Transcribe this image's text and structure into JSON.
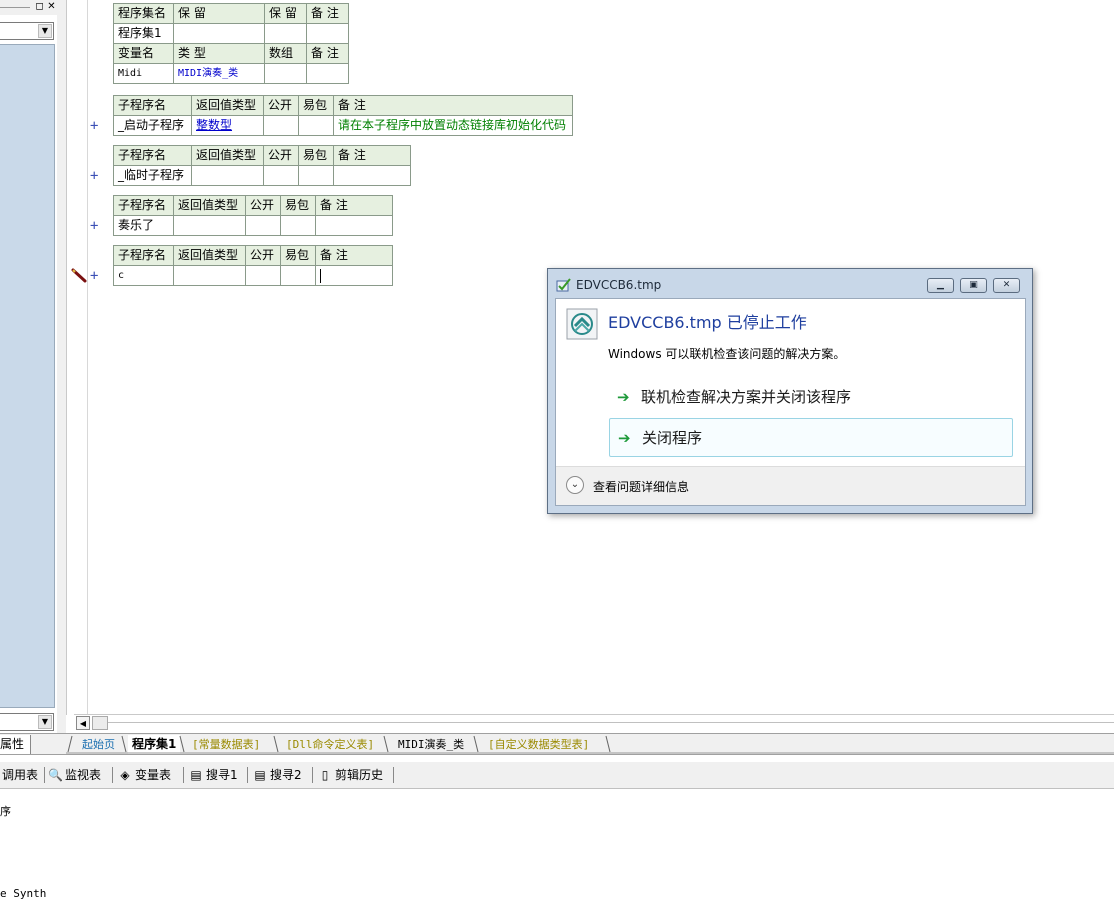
{
  "program_set_table": {
    "header1": [
      "程序集名",
      "保 留",
      "保 留",
      "备 注"
    ],
    "row1": [
      "程序集1",
      "",
      "",
      ""
    ],
    "header2": [
      "变量名",
      "类 型",
      "数组",
      "备 注"
    ],
    "row2": [
      "Midi",
      "MIDI演奏_类",
      "",
      ""
    ]
  },
  "sub_headers_long": [
    "子程序名",
    "返回值类型",
    "公开",
    "易包",
    "备 注"
  ],
  "sub_headers_short": [
    "子程序名",
    "返回值类型",
    "公开",
    "易包",
    "备 注"
  ],
  "subs": [
    {
      "name": "_启动子程序",
      "return_type": "整数型",
      "public": "",
      "easy": "",
      "note": "请在本子程序中放置动态链接库初始化代码"
    },
    {
      "name": "_临时子程序",
      "return_type": "",
      "public": "",
      "easy": "",
      "note": ""
    },
    {
      "name": "奏乐了",
      "return_type": "",
      "public": "",
      "easy": "",
      "note": ""
    },
    {
      "name": "c",
      "return_type": "",
      "public": "",
      "easy": "",
      "note": ""
    }
  ],
  "plus_symbol": "+",
  "left_panel": {
    "properties_tab": "属性"
  },
  "file_tabs": [
    {
      "label": "起始页",
      "color": "#1a6fb0"
    },
    {
      "label": "程序集1",
      "color": "#000000",
      "active": true
    },
    {
      "label": "[常量数据表]",
      "color": "#9a8a00"
    },
    {
      "label": "[Dll命令定义表]",
      "color": "#9a8a00"
    },
    {
      "label": "MIDI演奏_类",
      "color": "#000000"
    },
    {
      "label": "[自定义数据类型表]",
      "color": "#9a8a00"
    }
  ],
  "bottom_toolbar": [
    {
      "label": "调用表",
      "icon": "call-table-icon"
    },
    {
      "label": "监视表",
      "icon": "magnifier-icon"
    },
    {
      "label": "变量表",
      "icon": "variable-icon"
    },
    {
      "label": "搜寻1",
      "icon": "search-icon"
    },
    {
      "label": "搜寻2",
      "icon": "search-icon"
    },
    {
      "label": "剪辑历史",
      "icon": "clipboard-icon"
    }
  ],
  "output": {
    "line1": "序",
    "line2": "e Synth"
  },
  "dialog": {
    "title": "EDVCCB6.tmp",
    "heading": "EDVCCB6.tmp 已停止工作",
    "description": "Windows 可以联机检查该问题的解决方案。",
    "option1": "联机检查解决方案并关闭该程序",
    "option2": "关闭程序",
    "details": "查看问题详细信息"
  }
}
